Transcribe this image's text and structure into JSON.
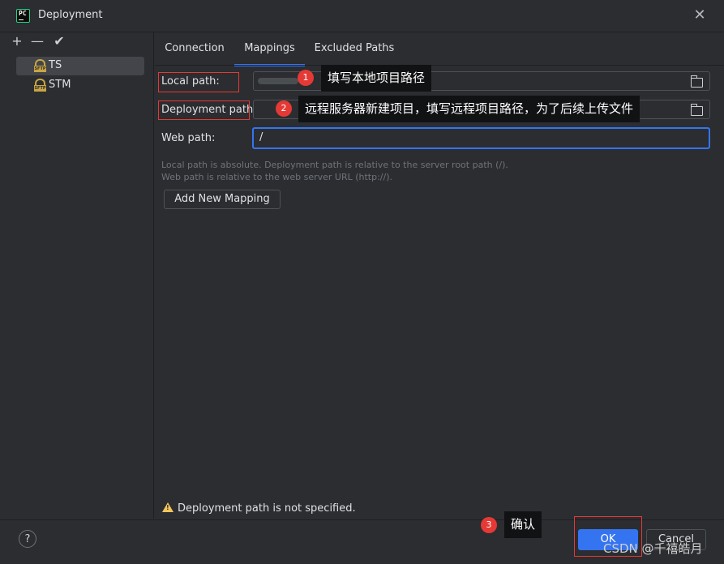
{
  "window": {
    "title": "Deployment",
    "app_icon_text": "PC"
  },
  "toolbar": {
    "add": "+",
    "remove": "—",
    "apply": "✔"
  },
  "servers": [
    {
      "label": "TS",
      "icon": "sftp-icon",
      "icon_text": "SFTP",
      "selected": true
    },
    {
      "label": "STM",
      "icon": "sftp-icon",
      "icon_text": "SFTP",
      "selected": false
    }
  ],
  "tabs": [
    {
      "label": "Connection",
      "active": false
    },
    {
      "label": "Mappings",
      "active": true
    },
    {
      "label": "Excluded Paths",
      "active": false
    }
  ],
  "mappings": {
    "local_path_label": "Local path:",
    "local_path_value": "",
    "deployment_path_label": "Deployment path:",
    "deployment_path_value": "",
    "web_path_label": "Web path:",
    "web_path_value": "/",
    "hint_line1": "Local path is absolute. Deployment path is relative to the server root path (/).",
    "hint_line2": "Web path is relative to the web server URL (http://).",
    "add_mapping_label": "Add New Mapping"
  },
  "status": {
    "warning_text": "Deployment path is not specified.",
    "warning_icon": "warning-icon"
  },
  "footer": {
    "help": "?",
    "ok": "OK",
    "cancel": "Cancel"
  },
  "annotations": [
    {
      "number": "1",
      "text": "填写本地项目路径"
    },
    {
      "number": "2",
      "text": "远程服务器新建项目，填写远程项目路径，为了后续上传文件"
    },
    {
      "number": "3",
      "text": "确认"
    }
  ],
  "watermark": "CSDN @千禧皓月",
  "colors": {
    "accent": "#3574f0",
    "annotation_red": "#e53935",
    "background": "#2b2d30",
    "warning": "#f2c55c"
  }
}
